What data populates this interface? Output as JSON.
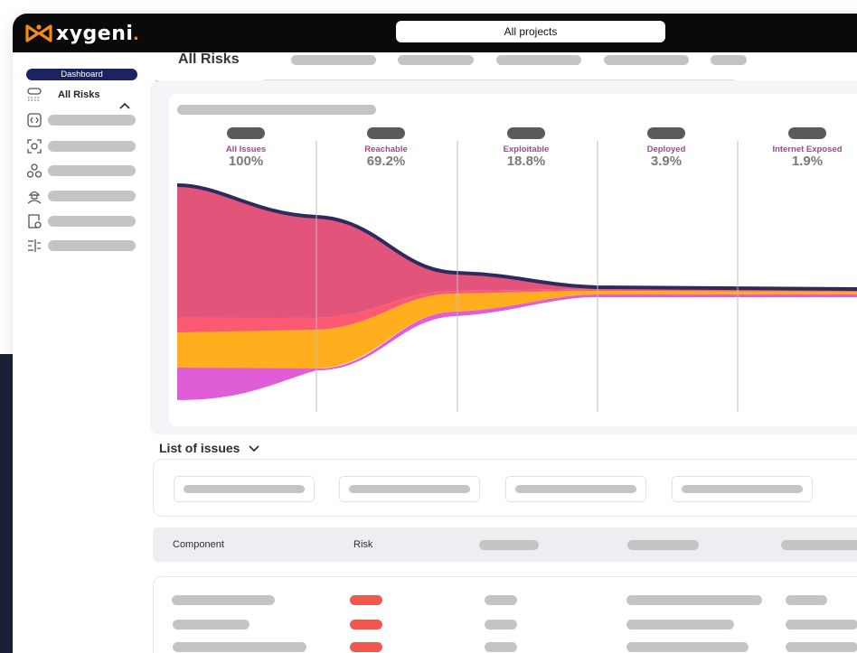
{
  "app": {
    "logo_text": "xygeni",
    "logo_dot": ".",
    "brand_color": "#f08a1c"
  },
  "topbar": {
    "project_selector": "All projects"
  },
  "sidebar": {
    "dashboard_label": "Dashboard",
    "current_item": "All Risks",
    "icons": [
      "code-review-icon",
      "scan-icon",
      "dependency-icon",
      "hacker-icon",
      "file-code-icon",
      "settings-sliders-icon"
    ]
  },
  "main": {
    "active_tab": "All Risks",
    "funnel": {
      "stages": [
        {
          "name": "All Issues",
          "percent": "100%"
        },
        {
          "name": "Reachable",
          "percent": "69.2%"
        },
        {
          "name": "Exploitable",
          "percent": "18.8%"
        },
        {
          "name": "Deployed",
          "percent": "3.9%"
        },
        {
          "name": "Internet Exposed",
          "percent": "1.9%"
        }
      ],
      "colors": {
        "critical": "#e2547a",
        "high_edge": "#2d2a5e",
        "high": "#fc5a72",
        "medium": "#ffae1e",
        "low": "#df5ed8"
      }
    },
    "issues": {
      "title": "List of issues",
      "columns": {
        "component": "Component",
        "risk": "Risk"
      },
      "risk_color": "#f2574e"
    }
  }
}
